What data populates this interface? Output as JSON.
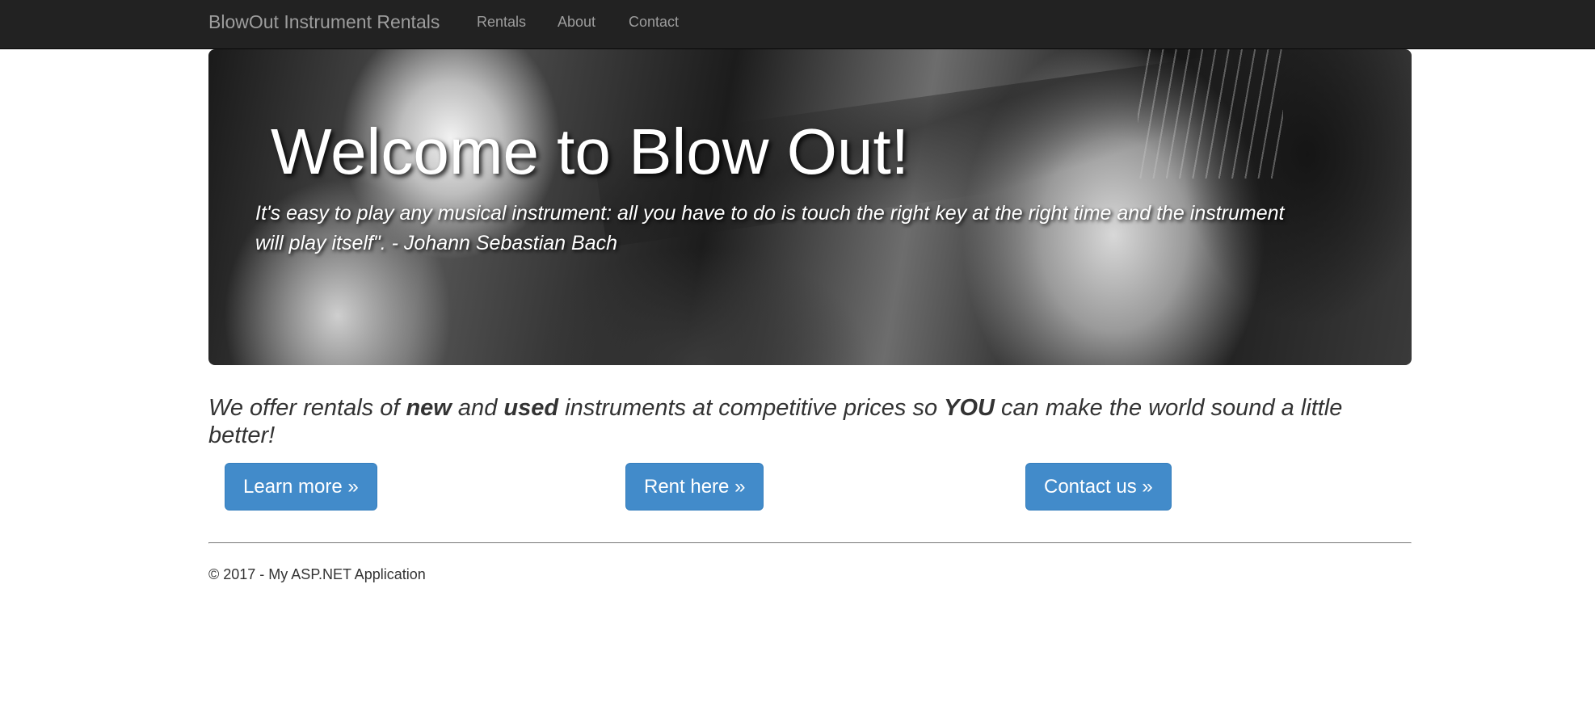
{
  "navbar": {
    "brand": "BlowOut Instrument Rentals",
    "links": [
      "Rentals",
      "About",
      "Contact"
    ]
  },
  "hero": {
    "title": "Welcome to Blow Out!",
    "quote": "It's easy to play any musical instrument: all you have to do is touch the right key at the right time and the instrument will play itself\". - Johann Sebastian Bach",
    "image": "black-and-white photo of a hand playing a guitar"
  },
  "lead": {
    "part1": "We offer rentals of ",
    "new": "new",
    "part2": " and ",
    "used": "used",
    "part3": " instruments at competitive prices so ",
    "you": "YOU",
    "part4": " can make the world sound a little better!"
  },
  "buttons": {
    "learn_more": "Learn more »",
    "rent_here": "Rent here »",
    "contact_us": "Contact us »"
  },
  "footer": {
    "text": "© 2017 - My ASP.NET Application"
  },
  "colors": {
    "navbar_bg": "#222222",
    "navbar_text": "#9d9d9d",
    "button_bg": "#428bca",
    "body_text": "#333333"
  }
}
